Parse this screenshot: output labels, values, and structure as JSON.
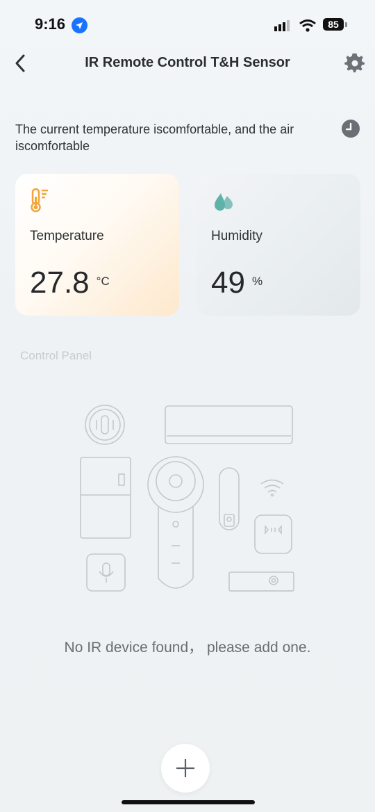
{
  "status_bar": {
    "time": "9:16",
    "battery": "85"
  },
  "header": {
    "title": "IR Remote Control T&H Sensor"
  },
  "status_message": "The current temperature iscomfortable, and the air iscomfortable",
  "cards": {
    "temperature": {
      "label": "Temperature",
      "value": "27.8",
      "unit": "°C"
    },
    "humidity": {
      "label": "Humidity",
      "value": "49",
      "unit": "%"
    }
  },
  "control_panel": {
    "title": "Control Panel"
  },
  "empty_message": "No IR device found， please add one.",
  "icons": [
    "location-icon",
    "signal-icon",
    "wifi-icon",
    "battery-icon",
    "back-icon",
    "gear-icon",
    "history-icon",
    "thermometer-icon",
    "droplet-icon",
    "plus-icon"
  ],
  "colors": {
    "accent_orange": "#f2a33a",
    "accent_teal": "#5fb2a9"
  }
}
